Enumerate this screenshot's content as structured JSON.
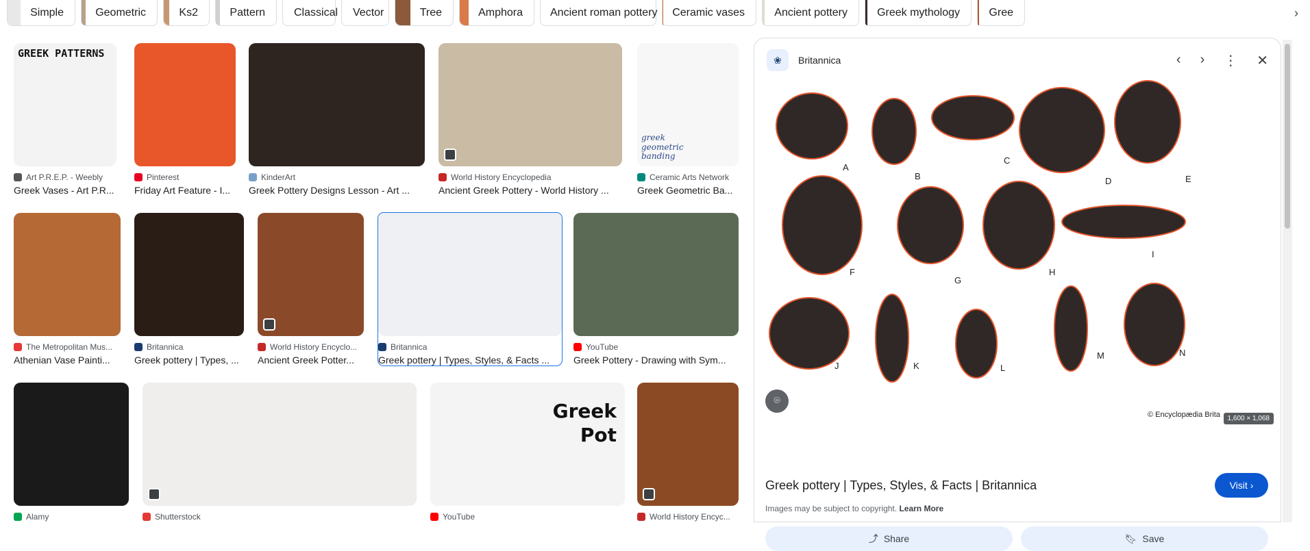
{
  "chips": [
    {
      "label": "Simple",
      "color": "#e8e8e8"
    },
    {
      "label": "Geometric",
      "color": "#b8a08a"
    },
    {
      "label": "Ks2",
      "color": "#c69872"
    },
    {
      "label": "Pattern",
      "color": "#d0d0d0"
    },
    {
      "label": "Classical",
      "color": ""
    },
    {
      "label": "Vector",
      "color": ""
    },
    {
      "label": "Tree",
      "color": "#8a5a3a"
    },
    {
      "label": "Amphora",
      "color": "#d97a4a"
    },
    {
      "label": "Ancient roman pottery",
      "color": "#a04030"
    },
    {
      "label": "Ceramic vases",
      "color": "#c8703a"
    },
    {
      "label": "Ancient pottery",
      "color": "#e0dcd0"
    },
    {
      "label": "Greek mythology",
      "color": "#3a2a2a"
    },
    {
      "label": "Gree",
      "color": "#b05a30"
    }
  ],
  "results": [
    {
      "source": "Art P.R.E.P. - Weebly",
      "title": "Greek Vases - Art P.R...",
      "bg": "#f3f3f3",
      "fav": "#555555"
    },
    {
      "source": "Pinterest",
      "title": "Friday Art Feature - I...",
      "bg": "#e8572a",
      "fav": "#e60023"
    },
    {
      "source": "KinderArt",
      "title": "Greek Pottery Designs Lesson - Art ...",
      "bg": "#2e2420",
      "fav": "#7aa0c8"
    },
    {
      "source": "World History Encyclopedia",
      "title": "Ancient Greek Pottery - World History ...",
      "bg": "#c9bba4",
      "fav": "#c62828"
    },
    {
      "source": "Ceramic Arts Network",
      "title": "Greek Geometric Ba...",
      "bg": "#f7f7f7",
      "fav": "#00897b"
    },
    {
      "source": "The Metropolitan Mus...",
      "title": "Athenian Vase Painti...",
      "bg": "#b56a35",
      "fav": "#e53935"
    },
    {
      "source": "Britannica",
      "title": "Greek pottery | Types, ...",
      "bg": "#2a1d16",
      "fav": "#1a3c6e"
    },
    {
      "source": "World History Encyclo...",
      "title": "Ancient Greek Potter...",
      "bg": "#8a4a2a",
      "fav": "#c62828"
    },
    {
      "source": "Britannica",
      "title": "Greek pottery | Types, Styles, & Facts ...",
      "bg": "#eef0f3",
      "fav": "#1a3c6e"
    },
    {
      "source": "YouTube",
      "title": "Greek Pottery - Drawing with Sym...",
      "bg": "#5a6a55",
      "fav": "#ff0000"
    },
    {
      "source": "Alamy",
      "title": "",
      "bg": "#1a1a1a",
      "fav": "#00a651"
    },
    {
      "source": "Shutterstock",
      "title": "",
      "bg": "#efeeec",
      "fav": "#e53935"
    },
    {
      "source": "YouTube",
      "title": "",
      "bg": "#f4f4f4",
      "fav": "#ff0000"
    },
    {
      "source": "World History Encyc...",
      "title": "",
      "bg": "#8c4a24",
      "fav": "#c62828"
    }
  ],
  "overlay_text": {
    "greek_patterns": "GREEK PATTERNS",
    "greek_geometric": "greek geometric banding",
    "greek_pot": "Greek Pot"
  },
  "panel": {
    "site": "Britannica",
    "title": "Greek pottery | Types, Styles, & Facts | Britannica",
    "copyright_note": "Images may be subject to copyright.",
    "learn_more": "Learn More",
    "visit_label": "Visit",
    "share_label": "Share",
    "save_label": "Save",
    "dimensions": "1,600 × 1,068",
    "image_credit": "© Encyclopædia Brita",
    "vessel_letters": [
      "A",
      "B",
      "C",
      "D",
      "E",
      "F",
      "G",
      "H",
      "I",
      "J",
      "K",
      "L",
      "M",
      "N"
    ],
    "vessel_fill": "#2f2826",
    "vessel_outline": "#e0542a"
  },
  "icons": {
    "prev": "‹",
    "next": "›",
    "more": "⋮",
    "close": "✕",
    "chip_next": "›"
  }
}
